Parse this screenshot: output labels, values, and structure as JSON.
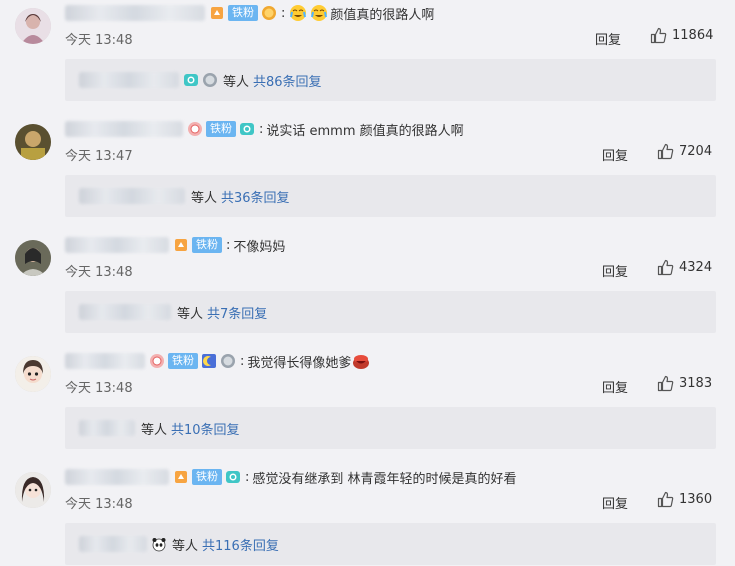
{
  "comments": [
    {
      "fan_tag": "铁粉",
      "text": "颜值真的很路人啊",
      "time": "今天 13:48",
      "reply_label": "回复",
      "likes": "11864",
      "sub_etc": "等人",
      "sub_link": "共86条回复"
    },
    {
      "fan_tag": "铁粉",
      "text": "说实话 emmm 颜值真的很路人啊",
      "time": "今天 13:47",
      "reply_label": "回复",
      "likes": "7204",
      "sub_etc": "等人",
      "sub_link": "共36条回复"
    },
    {
      "fan_tag": "铁粉",
      "text": "不像妈妈",
      "time": "今天 13:48",
      "reply_label": "回复",
      "likes": "4324",
      "sub_etc": "等人",
      "sub_link": "共7条回复"
    },
    {
      "fan_tag": "铁粉",
      "text": "我觉得长得像她爹",
      "time": "今天 13:48",
      "reply_label": "回复",
      "likes": "3183",
      "sub_etc": "等人",
      "sub_link": "共10条回复"
    },
    {
      "fan_tag": "铁粉",
      "text": "感觉没有继承到 林青霞年轻的时候是真的好看",
      "time": "今天 13:48",
      "reply_label": "回复",
      "likes": "1360",
      "sub_etc": "等人",
      "sub_link": "共116条回复"
    }
  ],
  "colors": {
    "fan_tag_bg": "#6bb5f1",
    "link": "#3a6fb4",
    "sub_box_bg": "#e8e8ec",
    "page_bg": "#f2f2f5"
  },
  "icons": [
    "avatar",
    "level-badge-icon",
    "fan-tag",
    "medal-icon",
    "camera-icon",
    "emoji-icon",
    "thumbs-up-icon"
  ]
}
